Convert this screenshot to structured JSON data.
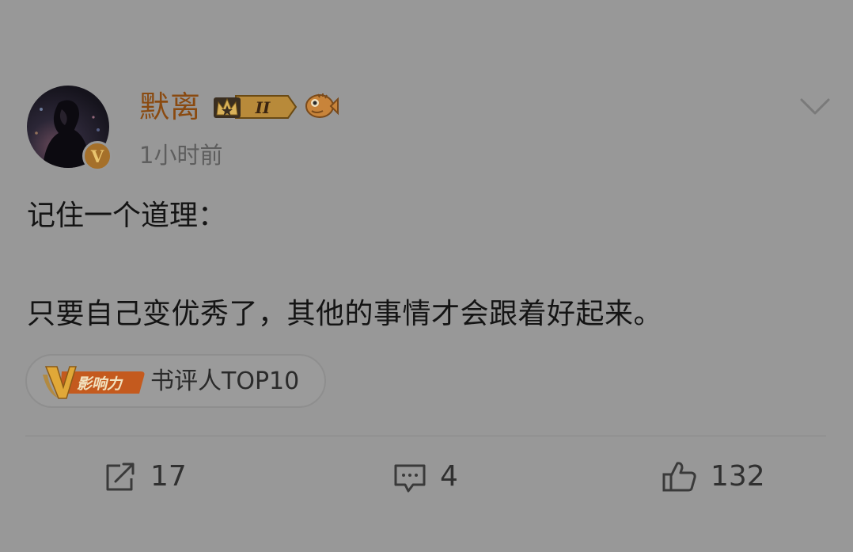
{
  "post": {
    "author": {
      "name": "默离",
      "level_badge_text": "II",
      "verified_mark": "V"
    },
    "time": "1小时前",
    "text_lines": [
      "记住一个道理：",
      "只要自己变优秀了，其他的事情才会跟着好起来。"
    ],
    "influence_chip": {
      "logo_letter": "V",
      "logo_text": "影响力",
      "label": "书评人TOP10"
    },
    "actions": {
      "repost_count": "17",
      "comment_count": "4",
      "like_count": "132"
    },
    "icons": {
      "menu": "chevron-down-icon",
      "repost": "share-icon",
      "comment": "comment-icon",
      "like": "thumbs-up-icon"
    },
    "colors": {
      "background": "#989898",
      "username": "#8a4a10",
      "timestamp": "#5e5e5e",
      "verified_badge": "#a5702a"
    }
  }
}
